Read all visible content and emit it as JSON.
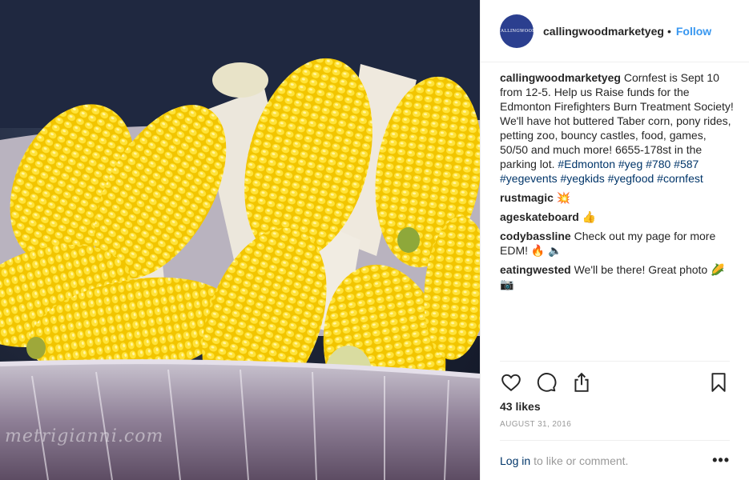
{
  "post": {
    "watermark": "metrigianni.com"
  },
  "header": {
    "avatar_text": "CALLINGWOOD",
    "username": "callingwoodmarketyeg",
    "dot": "•",
    "follow_label": "Follow"
  },
  "caption": {
    "username": "callingwoodmarketyeg",
    "text": "Cornfest is Sept 10 from 12-5. Help us Raise funds for the Edmonton Firefighters Burn Treatment Society! We'll have hot buttered Taber corn, pony rides, petting zoo, bouncy castles, food, games, 50/50 and much more! 6655-178st in the parking lot.",
    "hashtags": [
      "#Edmonton",
      "#yeg",
      "#780",
      "#587",
      "#yegevents",
      "#yegkids",
      "#yegfood",
      "#cornfest"
    ]
  },
  "comments": [
    {
      "username": "rustmagic",
      "text": "💥"
    },
    {
      "username": "ageskateboard",
      "text": "👍"
    },
    {
      "username": "codybassline",
      "text": "Check out my page for more EDM! 🔥 🔈"
    },
    {
      "username": "eatingwested",
      "text": "We'll be there! Great photo 🌽📷"
    }
  ],
  "likes": "43 likes",
  "date": "AUGUST 31, 2016",
  "footer": {
    "login_label": "Log in",
    "prompt": "to like or comment.",
    "more_label": "•••"
  },
  "icons": {
    "like": "heart-icon",
    "comment": "comment-icon",
    "share": "share-icon",
    "save": "bookmark-icon",
    "more": "more-options-icon"
  },
  "colors": {
    "link": "#3897f0",
    "hashtag": "#003569",
    "muted": "#999999",
    "avatar": "#2b3f8f"
  }
}
